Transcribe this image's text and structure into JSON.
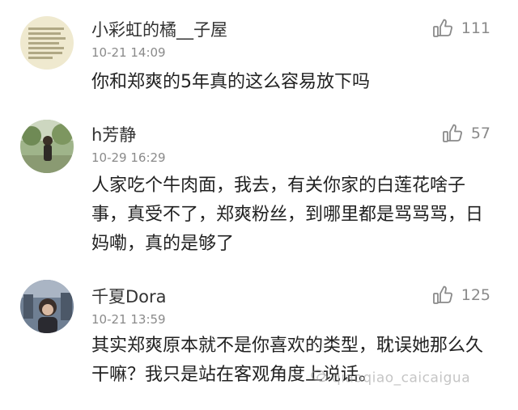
{
  "comments": [
    {
      "username": "小彩虹的橘__子屋",
      "time": "10-21 14:09",
      "likes": "111",
      "text": "你和郑爽的5年真的这么容易放下吗",
      "avatar_type": "text-image"
    },
    {
      "username": "h芳静",
      "time": "10-29 16:29",
      "likes": "57",
      "text": "人家吃个牛肉面，我去，有关你家的白莲花啥子事，真受不了，郑爽粉丝，到哪里都是骂骂骂，日妈嘞，真的是够了",
      "avatar_type": "photo-person-garden"
    },
    {
      "username": "千夏Dora",
      "time": "10-21 13:59",
      "likes": "125",
      "text": "其实郑爽原本就不是你喜欢的类型，耽误她那么久干嘛？我只是站在客观角度上说话。",
      "avatar_type": "photo-person-street"
    }
  ],
  "watermark": "qiaoqiao_caicaigua",
  "icons": {
    "like": "thumbs-up-icon",
    "watermark_logo": "chat-bubble-logo-icon"
  },
  "colors": {
    "text": "#222222",
    "meta": "#8a8a8a",
    "divider": "#e6e6e6"
  }
}
